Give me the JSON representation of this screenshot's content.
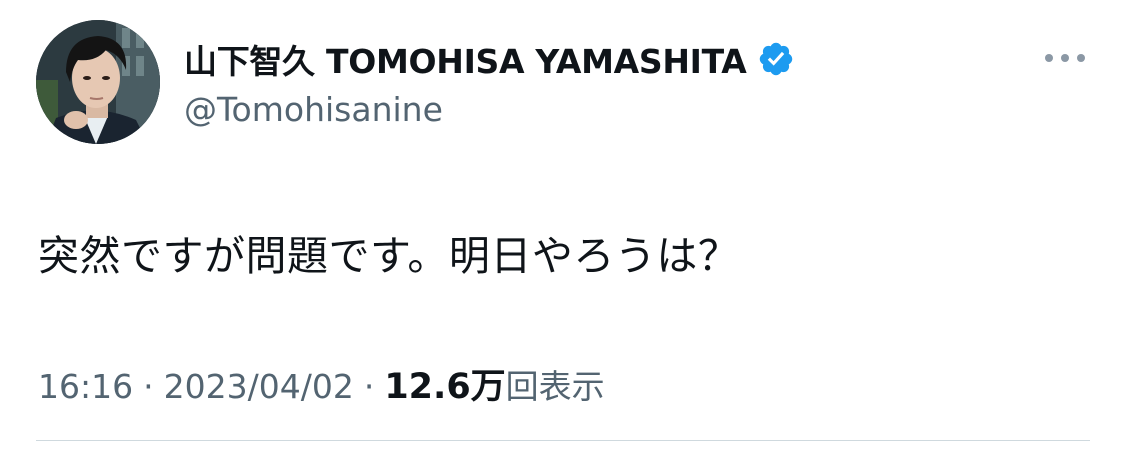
{
  "user": {
    "display_name": "山下智久 TOMOHISA YAMASHITA",
    "handle": "@Tomohisanine",
    "verified_icon": "verified-badge-icon",
    "avatar_icon": "profile-photo"
  },
  "more_icon": "more-horizontal-icon",
  "tweet": {
    "text": "突然ですが問題です。明日やろうは？"
  },
  "meta": {
    "time": "16:16",
    "separator": "·",
    "date": "2023/04/02",
    "views_count": "12.6万",
    "views_label": "回表示"
  },
  "colors": {
    "verified_blue": "#1d9bf0",
    "secondary_text": "#536471",
    "primary_text": "#0f1419",
    "divider": "#cfd9de"
  }
}
